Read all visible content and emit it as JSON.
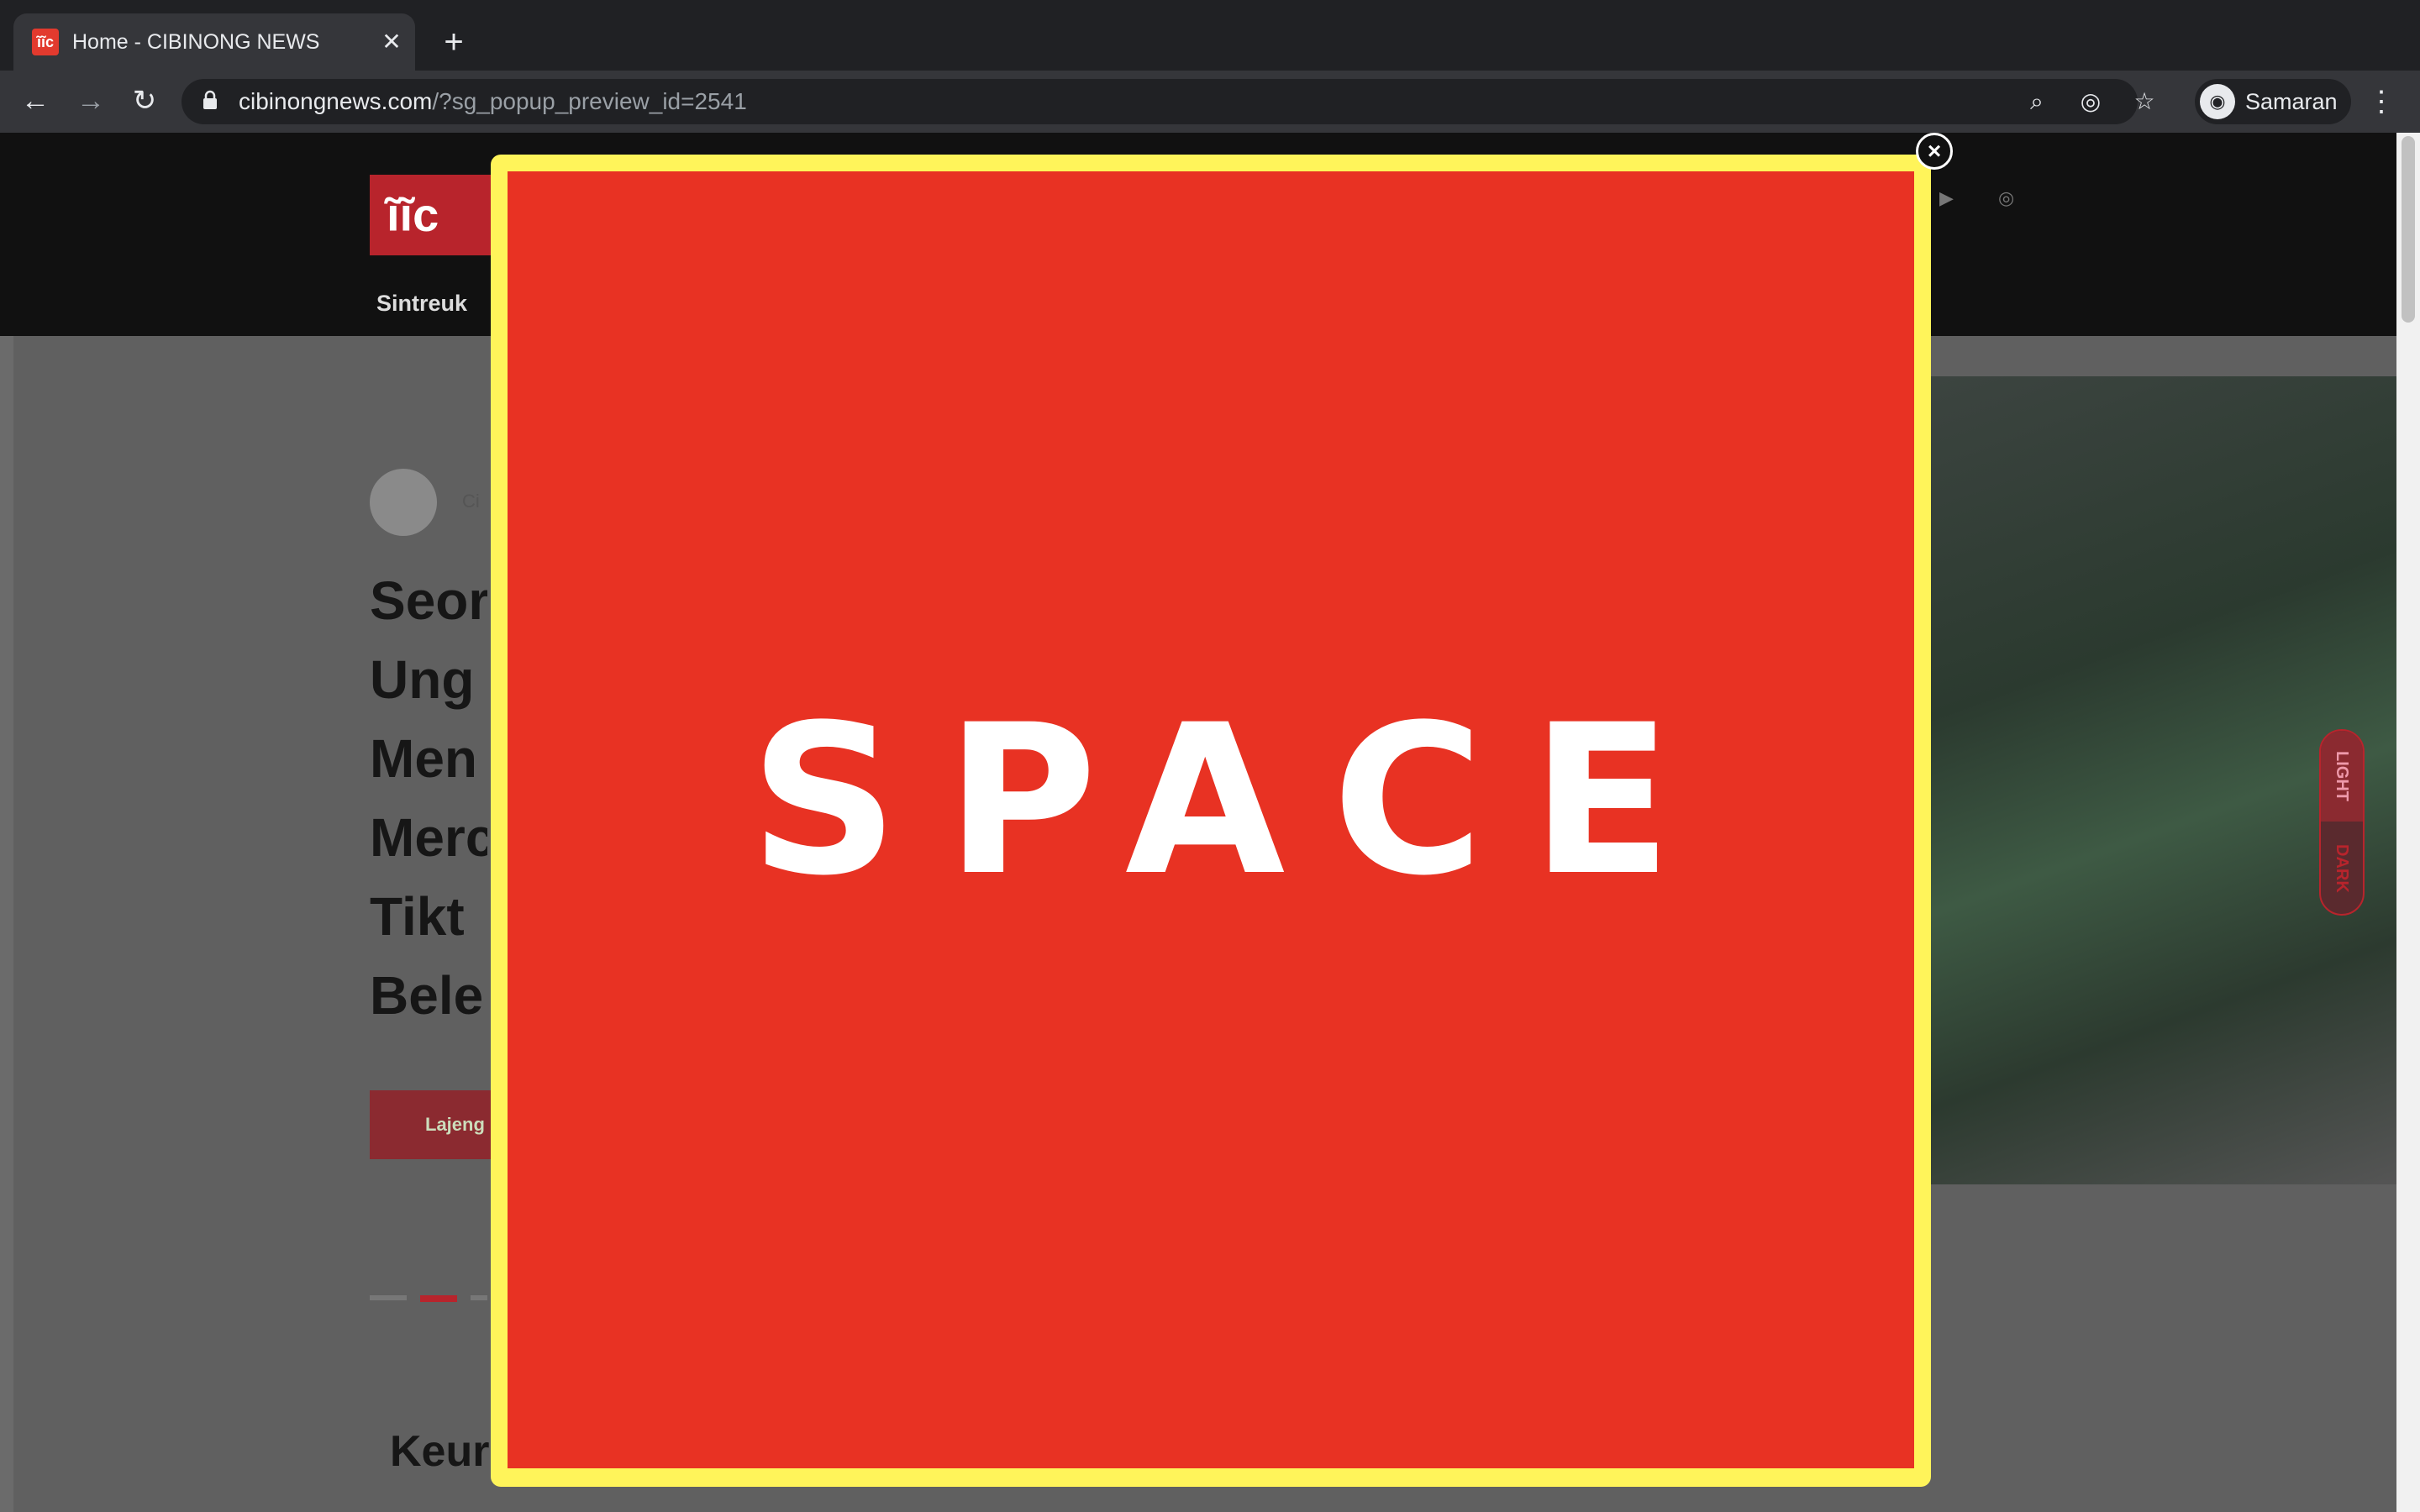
{
  "browser": {
    "tab": {
      "favicon": "ĩĩc",
      "title": "Home - CIBINONG NEWS",
      "close": "✕"
    },
    "new_tab": "+",
    "nav": {
      "back": "←",
      "forward": "→",
      "reload": "↻"
    },
    "lock": "🔒",
    "url_host": "cibinongnews.com",
    "url_path": "/?sg_popup_preview_id=2541",
    "icons": {
      "zoom": "⌕",
      "eye_off": "◎",
      "star": "☆",
      "menu": "⋮"
    },
    "profile": {
      "avatar": "◉",
      "name": "Samaran"
    }
  },
  "site": {
    "logo": "ĩĩc",
    "nav_item": "Sintreuk",
    "social": {
      "youtube": "▶",
      "instagram": "◎"
    },
    "author": "Ci",
    "headline_lines": [
      "Seor",
      "Ung",
      "Men",
      "Merc",
      "Tikt",
      "Bele"
    ],
    "read_more": "Lajeng",
    "section_title": "Keur",
    "mode_toggle": {
      "light": "LIGHT",
      "dark": "DARK"
    }
  },
  "popup": {
    "text": "SPACE",
    "close": "×",
    "colors": {
      "border": "#fff45a",
      "background": "#e83223"
    }
  }
}
